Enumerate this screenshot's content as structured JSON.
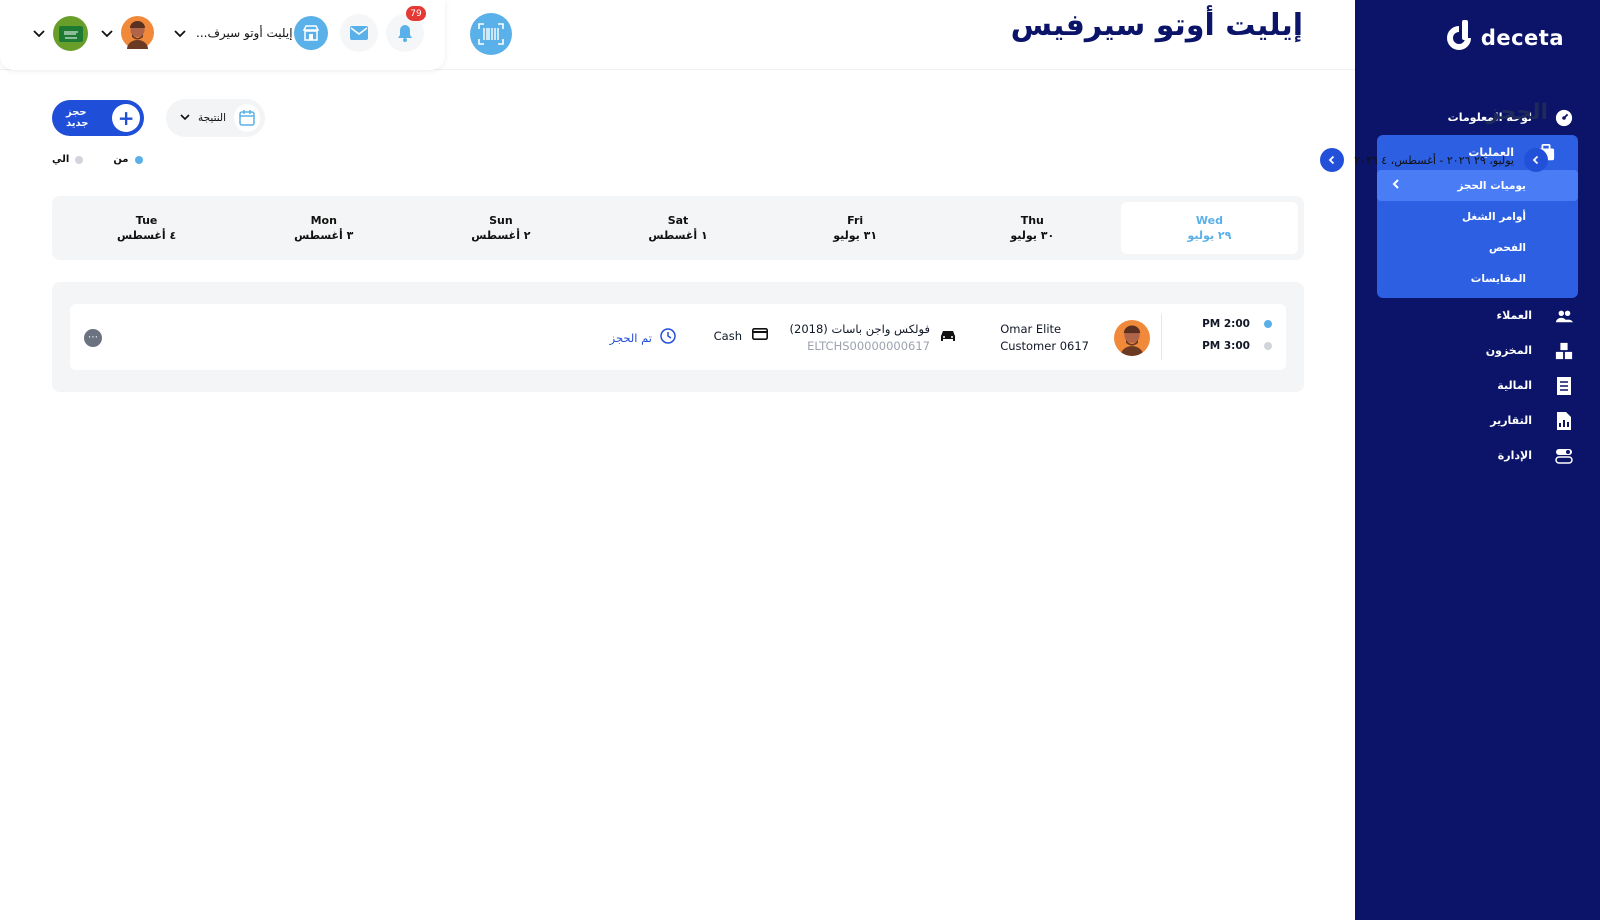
{
  "brand": {
    "logo_text": "deceta"
  },
  "header": {
    "company_title": "إيليت أوتو سيرفيس",
    "notification_count": "79",
    "branch_label": "إيليت أوتو سيرف..."
  },
  "sidebar": {
    "items": [
      {
        "label": "لوحة المعلومات",
        "icon": "dashboard-icon"
      },
      {
        "label": "العمليات",
        "icon": "briefcase-icon"
      },
      {
        "label": "العملاء",
        "icon": "users-icon"
      },
      {
        "label": "المخزون",
        "icon": "inventory-icon"
      },
      {
        "label": "المالية",
        "icon": "receipt-icon"
      },
      {
        "label": "التقارير",
        "icon": "report-icon"
      },
      {
        "label": "الإدارة",
        "icon": "toggle-icon"
      }
    ],
    "operations_sub": [
      {
        "label": "يوميات الحجز",
        "active": true
      },
      {
        "label": "أوامر الشغل"
      },
      {
        "label": "الفحص"
      },
      {
        "label": "المقايسات"
      }
    ]
  },
  "page": {
    "title": "الحجز",
    "date_range": "يوليو، ٢٩ ٢٠٢٦ - أغسطس، ٤ ٢٠٢٦",
    "new_booking": "حجز جديد",
    "result_select": "النتيجة",
    "legend_from": "من",
    "legend_to": "الي"
  },
  "days": [
    {
      "name": "Wed",
      "date": "٢٩ يوليو",
      "active": true
    },
    {
      "name": "Thu",
      "date": "٣٠ يوليو"
    },
    {
      "name": "Fri",
      "date": "٣١ يوليو"
    },
    {
      "name": "Sat",
      "date": "١ أغسطس"
    },
    {
      "name": "Sun",
      "date": "٢ أغسطس"
    },
    {
      "name": "Mon",
      "date": "٣ أغسطس"
    },
    {
      "name": "Tue",
      "date": "٤ أغسطس"
    }
  ],
  "booking": {
    "start_time": "2:00 PM",
    "end_time": "3:00 PM",
    "customer_line1": "Omar Elite",
    "customer_line2": "Customer 0617",
    "vehicle": "فولكس واجن باسات (2018)",
    "plate": "ELTCHS00000000617",
    "payment": "Cash",
    "status": "تم الحجز"
  },
  "colors": {
    "sidebar_bg": "#0b1468",
    "accent": "#2350d8",
    "active_day": "#5ab0e8"
  }
}
